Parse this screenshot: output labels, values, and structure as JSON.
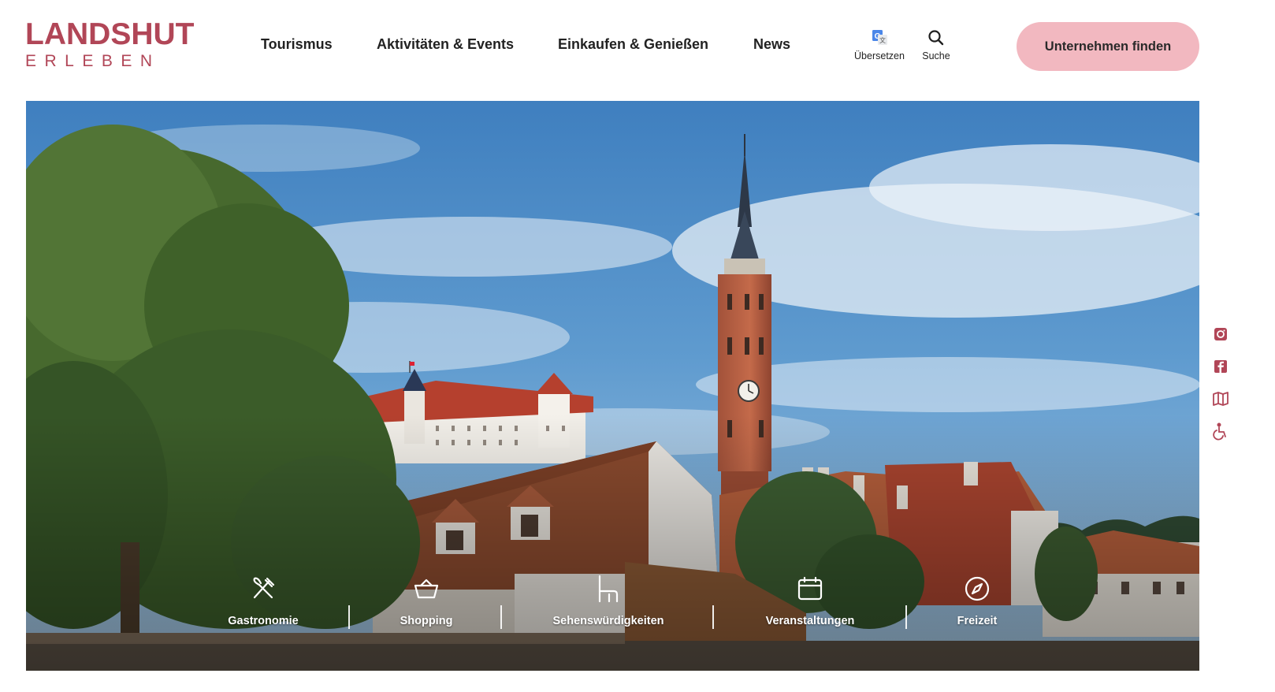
{
  "brand": {
    "logo_line1": "LANDSHUT",
    "logo_line2": "ERLEBEN",
    "color": "#b14657"
  },
  "nav": {
    "items": [
      {
        "label": "Tourismus"
      },
      {
        "label": "Aktivitäten & Events"
      },
      {
        "label": "Einkaufen & Genießen"
      },
      {
        "label": "News"
      }
    ]
  },
  "tools": {
    "translate": {
      "label": "Übersetzen",
      "icon": "google-translate-icon"
    },
    "search": {
      "label": "Suche",
      "icon": "search-icon"
    }
  },
  "cta": {
    "label": "Unternehmen finden",
    "color": "#f2b8c0"
  },
  "hero": {
    "categories": [
      {
        "label": "Gastronomie",
        "icon": "fork-knife-icon"
      },
      {
        "label": "Shopping",
        "icon": "basket-icon"
      },
      {
        "label": "Sehenswürdigkeiten",
        "icon": "chair-icon"
      },
      {
        "label": "Veranstaltungen",
        "icon": "calendar-icon"
      },
      {
        "label": "Freizeit",
        "icon": "compass-icon"
      }
    ]
  },
  "side_links": [
    {
      "icon": "instagram-icon"
    },
    {
      "icon": "facebook-icon"
    },
    {
      "icon": "map-icon"
    },
    {
      "icon": "wheelchair-icon"
    }
  ]
}
